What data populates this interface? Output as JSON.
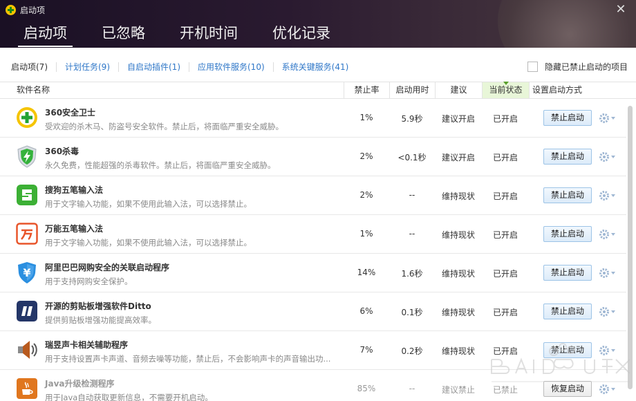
{
  "window": {
    "title": "启动项"
  },
  "main_tabs": [
    {
      "label": "启动项"
    },
    {
      "label": "已忽略"
    },
    {
      "label": "开机时间"
    },
    {
      "label": "优化记录"
    }
  ],
  "sub_tabs": [
    {
      "label": "启动项(7)"
    },
    {
      "label": "计划任务(9)"
    },
    {
      "label": "自启动插件(1)"
    },
    {
      "label": "应用软件服务(10)"
    },
    {
      "label": "系统关键服务(41)"
    }
  ],
  "hide_disabled_label": "隐藏已禁止启动的项目",
  "columns": {
    "name": "软件名称",
    "rate": "禁止率",
    "time": "启动用时",
    "suggest": "建议",
    "state": "当前状态",
    "setting": "设置启动方式"
  },
  "rows": [
    {
      "title": "360安全卫士",
      "desc": "受欢迎的杀木马、防盗号安全软件。禁止后，将面临严重安全威胁。",
      "rate": "1%",
      "time": "5.9秒",
      "suggest": "建议开启",
      "state": "已开启",
      "action": "禁止启动",
      "icon": "360-safe-icon"
    },
    {
      "title": "360杀毒",
      "desc": "永久免费，性能超强的杀毒软件。禁止后，将面临严重安全威胁。",
      "rate": "2%",
      "time": "<0.1秒",
      "suggest": "建议开启",
      "state": "已开启",
      "action": "禁止启动",
      "icon": "360-antivirus-shield-icon"
    },
    {
      "title": "搜狗五笔输入法",
      "desc": "用于文字输入功能，如果不使用此输入法，可以选择禁止。",
      "rate": "2%",
      "time": "--",
      "suggest": "维持现状",
      "state": "已开启",
      "action": "禁止启动",
      "icon": "sogou-input-icon"
    },
    {
      "title": "万能五笔输入法",
      "desc": "用于文字输入功能，如果不使用此输入法，可以选择禁止。",
      "rate": "1%",
      "time": "--",
      "suggest": "维持现状",
      "state": "已开启",
      "action": "禁止启动",
      "icon": "wanneng-input-icon"
    },
    {
      "title": "阿里巴巴网购安全的关联启动程序",
      "desc": "用于支持网购安全保护。",
      "rate": "14%",
      "time": "1.6秒",
      "suggest": "维持现状",
      "state": "已开启",
      "action": "禁止启动",
      "icon": "alibaba-shield-icon"
    },
    {
      "title": "开源的剪贴板增强软件Ditto",
      "desc": "提供剪贴板增强功能提高效率。",
      "rate": "6%",
      "time": "0.1秒",
      "suggest": "维持现状",
      "state": "已开启",
      "action": "禁止启动",
      "icon": "ditto-quote-icon"
    },
    {
      "title": "瑞昱声卡相关辅助程序",
      "desc": "用于支持设置声卡声道、音频去噪等功能，禁止后，不会影响声卡的声音输出功...",
      "rate": "7%",
      "time": "0.2秒",
      "suggest": "维持现状",
      "state": "已开启",
      "action": "禁止启动",
      "icon": "speaker-icon"
    },
    {
      "title": "Java升级检测程序",
      "desc": "用于Java自动获取更新信息，不需要开机启动。",
      "rate": "85%",
      "time": "--",
      "suggest": "建议禁止",
      "state": "已禁止",
      "action": "恢复启动",
      "icon": "java-cup-icon",
      "disabled": true
    }
  ],
  "colors": {
    "accent": "#2f77c8",
    "state_header": "#e8f6d8",
    "button_border": "#9cc3e6"
  }
}
